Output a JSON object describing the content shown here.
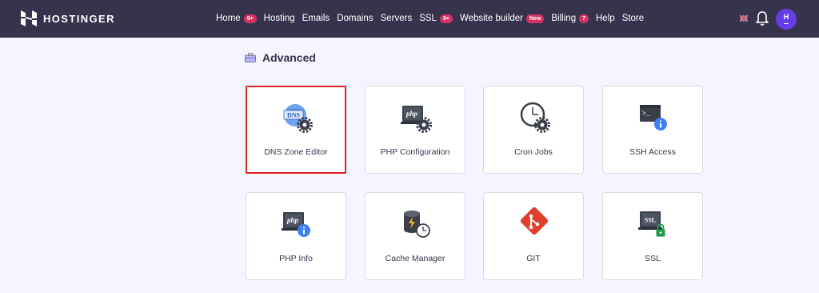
{
  "brand": {
    "name": "HOSTINGER"
  },
  "nav": [
    {
      "label": "Home",
      "badge": "9+"
    },
    {
      "label": "Hosting",
      "badge": ""
    },
    {
      "label": "Emails",
      "badge": ""
    },
    {
      "label": "Domains",
      "badge": ""
    },
    {
      "label": "Servers",
      "badge": ""
    },
    {
      "label": "SSL",
      "badge": "9+"
    },
    {
      "label": "Website builder",
      "badge": "New"
    },
    {
      "label": "Billing",
      "badge": "7"
    },
    {
      "label": "Help",
      "badge": ""
    },
    {
      "label": "Store",
      "badge": ""
    }
  ],
  "header_right": {
    "flag_icon": "uk-flag-icon",
    "bell_icon": "bell-icon",
    "avatar_letter": "H"
  },
  "section": {
    "title": "Advanced",
    "icon": "toolbox-icon"
  },
  "tiles": [
    {
      "label": "DNS Zone Editor",
      "icon": "dns-gear-icon",
      "selected": true
    },
    {
      "label": "PHP Configuration",
      "icon": "php-gear-icon",
      "selected": false
    },
    {
      "label": "Cron Jobs",
      "icon": "clock-gear-icon",
      "selected": false
    },
    {
      "label": "SSH Access",
      "icon": "terminal-info-icon",
      "selected": false
    },
    {
      "label": "PHP Info",
      "icon": "php-info-icon",
      "selected": false
    },
    {
      "label": "Cache Manager",
      "icon": "database-clock-icon",
      "selected": false
    },
    {
      "label": "GIT",
      "icon": "git-icon",
      "selected": false
    },
    {
      "label": "SSL",
      "icon": "ssl-lock-icon",
      "selected": false
    }
  ],
  "colors": {
    "topbar": "#36344d",
    "page_bg": "#f4f5ff",
    "badge": "#d63163",
    "selected_outline": "#e0211e",
    "info_blue": "#3d7ff5",
    "git_red": "#e03f2b",
    "lock_green": "#1e9e4a"
  }
}
